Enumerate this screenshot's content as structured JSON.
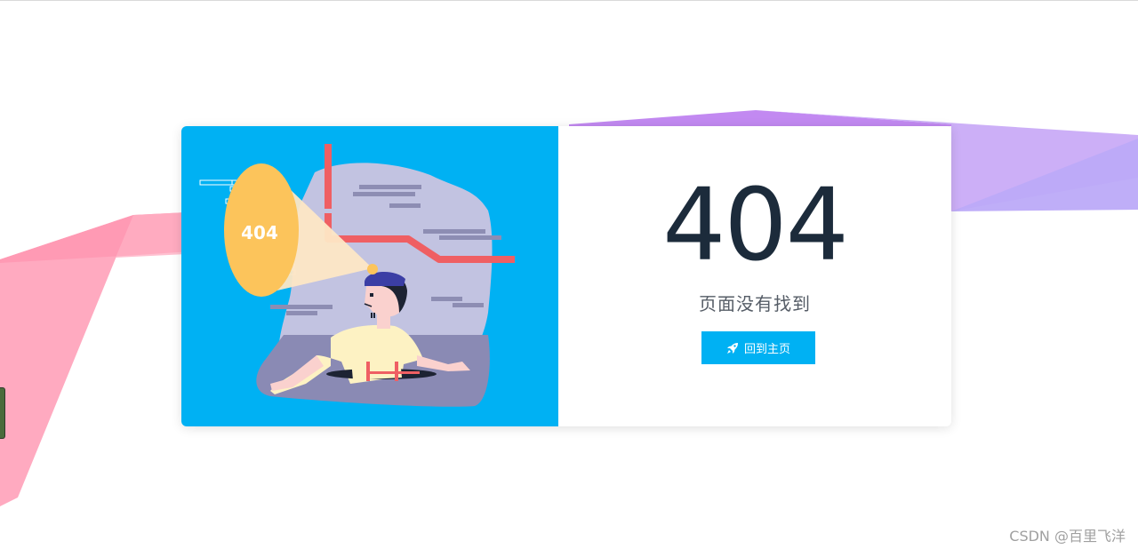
{
  "error": {
    "code": "404",
    "message": "页面没有找到",
    "home_button_label": "回到主页",
    "illustration_text": "404"
  },
  "watermark": "CSDN @百里飞洋",
  "colors": {
    "accent": "#00b1f3",
    "code_text": "#1c2b3b",
    "ribbon_pink": "#ff8fb0",
    "ribbon_purple": "#c3a3f5"
  },
  "icons": {
    "button_icon": "rocket-icon"
  }
}
